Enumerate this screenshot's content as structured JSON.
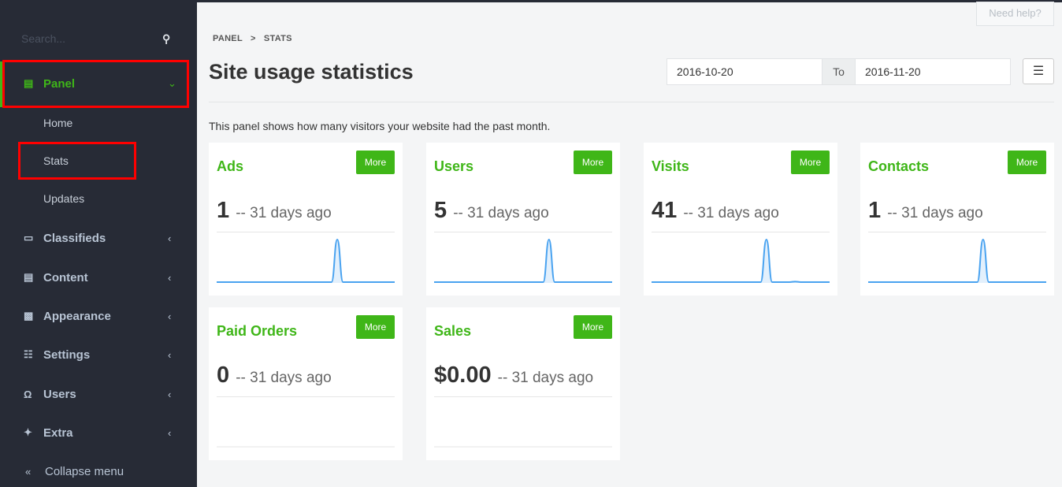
{
  "sidebar": {
    "search_placeholder": "Search...",
    "items": [
      {
        "label": "Panel",
        "icon": "monitor-icon",
        "expanded": true,
        "children": [
          "Home",
          "Stats",
          "Updates"
        ]
      },
      {
        "label": "Classifieds",
        "icon": "tag-icon"
      },
      {
        "label": "Content",
        "icon": "newspaper-icon"
      },
      {
        "label": "Appearance",
        "icon": "image-icon"
      },
      {
        "label": "Settings",
        "icon": "sliders-icon"
      },
      {
        "label": "Users",
        "icon": "user-icon"
      },
      {
        "label": "Extra",
        "icon": "magic-icon"
      }
    ],
    "collapse": "Collapse menu"
  },
  "header": {
    "help": "Need help?",
    "breadcrumb": [
      "PANEL",
      "STATS"
    ],
    "title": "Site usage statistics",
    "date_from": "2016-10-20",
    "to": "To",
    "date_to": "2016-11-20"
  },
  "description": "This panel shows how many visitors your website had the past month.",
  "more_label": "More",
  "colors": {
    "accent": "#3fb618",
    "sidebar": "#272b36",
    "spark": "#4aa3f0"
  },
  "cards": [
    {
      "title": "Ads",
      "value": "1",
      "ago": "-- 31 days ago",
      "series": [
        0,
        0,
        0,
        0,
        0,
        0,
        0,
        0,
        0,
        0,
        0,
        0,
        0,
        0,
        0,
        0,
        0,
        0,
        0,
        0,
        0,
        1,
        0,
        0,
        0,
        0,
        0,
        0,
        0,
        0,
        0,
        0
      ]
    },
    {
      "title": "Users",
      "value": "5",
      "ago": "-- 31 days ago",
      "series": [
        0,
        0,
        0,
        0,
        0,
        0,
        0,
        0,
        0,
        0,
        0,
        0,
        0,
        0,
        0,
        0,
        0,
        0,
        0,
        0,
        5,
        0,
        0,
        0,
        0,
        0,
        0,
        0,
        0,
        0,
        0,
        0
      ]
    },
    {
      "title": "Visits",
      "value": "41",
      "ago": "-- 31 days ago",
      "series": [
        0,
        0,
        0,
        0,
        0,
        0,
        0,
        0,
        0,
        0,
        0,
        0,
        0,
        0,
        0,
        0,
        0,
        0,
        0,
        0,
        41,
        0,
        0,
        0,
        0,
        0.5,
        0,
        0,
        0,
        0,
        0,
        0
      ]
    },
    {
      "title": "Contacts",
      "value": "1",
      "ago": "-- 31 days ago",
      "series": [
        0,
        0,
        0,
        0,
        0,
        0,
        0,
        0,
        0,
        0,
        0,
        0,
        0,
        0,
        0,
        0,
        0,
        0,
        0,
        0,
        1,
        0,
        0,
        0,
        0,
        0,
        0,
        0,
        0,
        0,
        0,
        0
      ]
    },
    {
      "title": "Paid Orders",
      "value": "0",
      "ago": "-- 31 days ago",
      "series": []
    },
    {
      "title": "Sales",
      "value": "$0.00",
      "ago": "-- 31 days ago",
      "series": []
    }
  ]
}
